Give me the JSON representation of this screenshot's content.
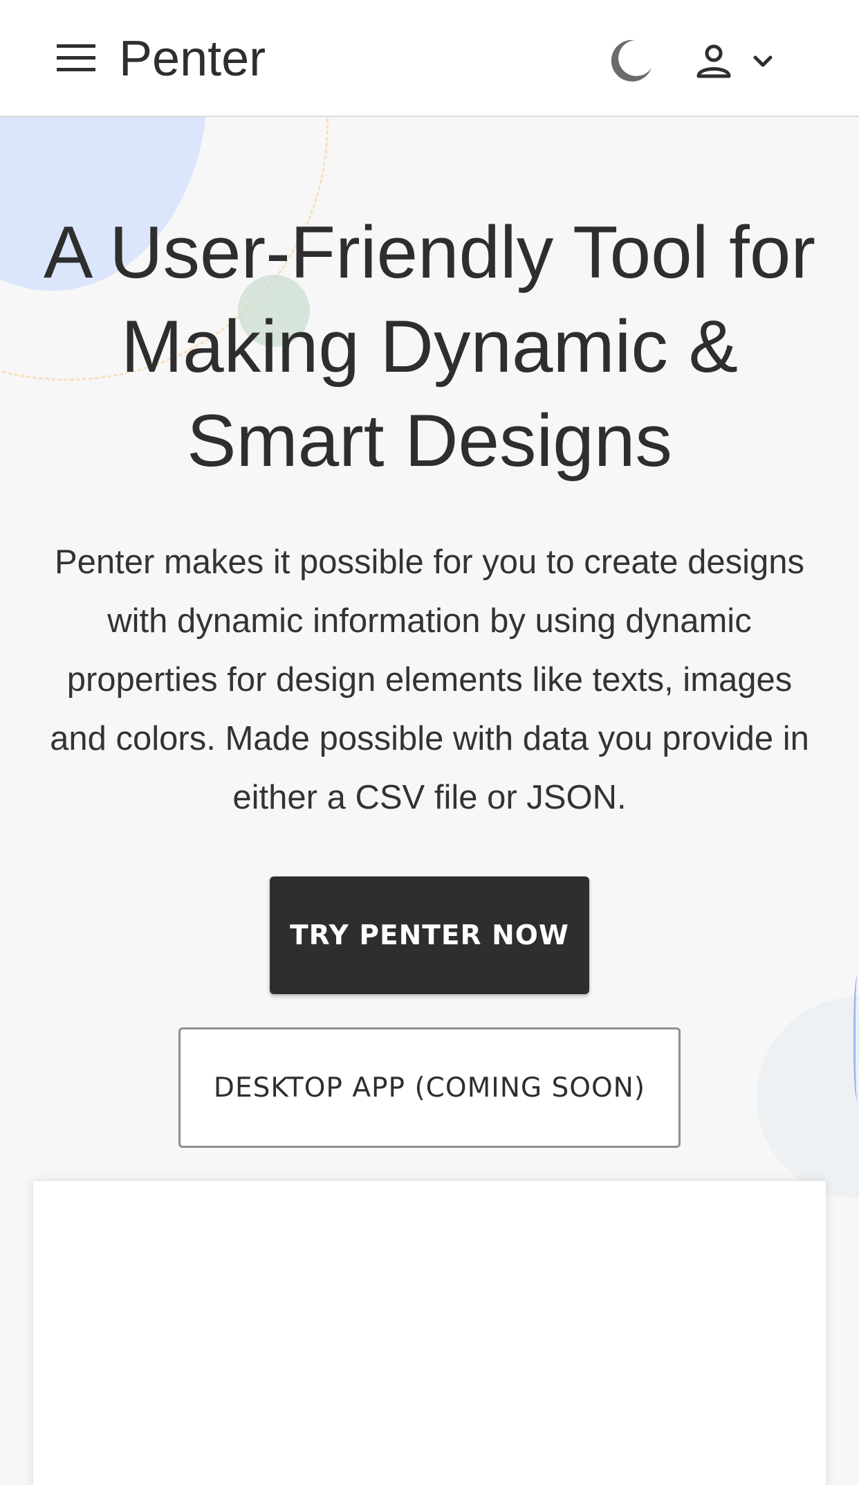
{
  "header": {
    "app_name": "Penter",
    "menu_icon": "hamburger-menu-icon",
    "theme_icon": "moon-icon",
    "account_icon": "person-icon",
    "account_dropdown_icon": "chevron-down-icon"
  },
  "hero": {
    "title": "A User-Friendly Tool for Making Dynamic & Smart Designs",
    "description": "Penter makes it possible for you to create designs with dynamic information by using dynamic properties for design elements like texts, images and colors. Made possible with data you provide in either a CSV file or JSON.",
    "primary_button": "TRY PENTER NOW",
    "secondary_button": "DESKTOP APP (COMING SOON)"
  },
  "colors": {
    "primary": "#2e2e2e",
    "background": "#f7f7f7",
    "surface": "#ffffff",
    "deco_blue": "#dbe6fd",
    "deco_orange": "#f9dfc0",
    "deco_green": "#c8dccd"
  }
}
